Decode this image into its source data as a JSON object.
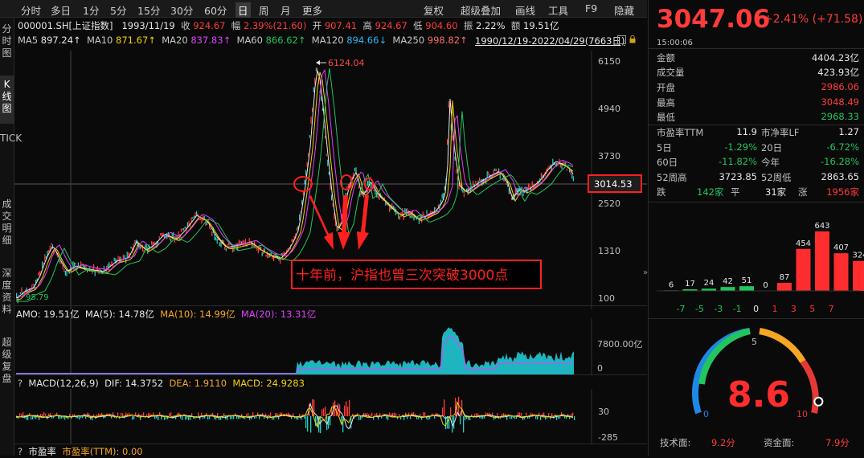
{
  "toolbar": {
    "periods": [
      "分时",
      "多日",
      "1分",
      "5分",
      "15分",
      "30分",
      "60分",
      "日",
      "周",
      "月",
      "更多"
    ],
    "active": "日",
    "tools": [
      "复权",
      "超级叠加",
      "画线",
      "工具",
      "F9",
      "隐藏"
    ]
  },
  "left_tabs": [
    "分时图",
    "K线图",
    "TICK",
    "成交明细",
    "深度资料",
    "超级复盘"
  ],
  "quote_line": {
    "code": "000001.SH[上证指数]",
    "date": "1993/11/19",
    "close_label": "收",
    "close": "924.67",
    "amp_label": "幅",
    "amp": "2.39%(21.60)",
    "open_label": "开",
    "open": "907.41",
    "high_label": "高",
    "high": "924.67",
    "low_label": "低",
    "low": "904.60",
    "swing_label": "振",
    "swing": "2.22%",
    "amount_label": "额",
    "amount": "19.51亿"
  },
  "ma_line": {
    "items": [
      {
        "label": "MA5",
        "value": "897.24↑",
        "color": "#e6e6e6"
      },
      {
        "label": "MA10",
        "value": "871.67↑",
        "color": "#f5d000"
      },
      {
        "label": "MA20",
        "value": "837.83↑",
        "color": "#e040fb"
      },
      {
        "label": "MA60",
        "value": "866.62↑",
        "color": "#22c55e"
      },
      {
        "label": "MA120",
        "value": "894.66↓",
        "color": "#29b6f6"
      },
      {
        "label": "MA250",
        "value": "998.82↑",
        "color": "#ff6b6b"
      }
    ],
    "range": "1990/12/19-2022/04/29(7663日)"
  },
  "chart": {
    "y_ticks": [
      "6150",
      "4940",
      "3730",
      "2520",
      "1310",
      "100"
    ],
    "peak_label": "6124.04",
    "low_label": "95.79",
    "current_price_tag": "3014.53",
    "annotation": "十年前，沪指也曾三次突破3000点"
  },
  "volume": {
    "legend": [
      {
        "label": "AMO: 19.51亿",
        "color": "#e6e6e6"
      },
      {
        "label": "MA(5): 14.78亿",
        "color": "#e6e6e6"
      },
      {
        "label": "MA(10): 14.99亿",
        "color": "#f5a623"
      },
      {
        "label": "MA(20): 13.31亿",
        "color": "#e040fb"
      }
    ],
    "y_ticks": [
      "7800.00亿",
      "0"
    ]
  },
  "macd": {
    "help": "?",
    "legend": [
      {
        "label": "MACD(12,26,9)",
        "color": "#e6e6e6"
      },
      {
        "label": "DIF: 14.3752",
        "color": "#e6e6e6"
      },
      {
        "label": "DEA: 1.9110",
        "color": "#f5a623"
      },
      {
        "label": "MACD: 24.9283",
        "color": "#f5d000"
      }
    ],
    "y_ticks": [
      "30",
      "-285"
    ]
  },
  "bottom_bar": {
    "help": "?",
    "label": "市盈率",
    "value": "市盈率(TTM): 0.00"
  },
  "right_panel": {
    "price": "3047.06",
    "change": "+2.41% (+71.58)",
    "time": "15:00:06",
    "rows": [
      {
        "k": "金额",
        "v": "4404.23亿",
        "color": "#e6e6e6"
      },
      {
        "k": "成交量",
        "v": "423.93亿",
        "color": "#e6e6e6"
      },
      {
        "k": "开盘",
        "v": "2986.06",
        "color": "#ff3b3b"
      },
      {
        "k": "最高",
        "v": "3048.49",
        "color": "#ff3b3b"
      },
      {
        "k": "最低",
        "v": "2968.33",
        "color": "#22c55e"
      }
    ],
    "pairs": [
      {
        "k1": "市盈率TTM",
        "v1": "11.9",
        "c1": "#e6e6e6",
        "k2": "市净率LF",
        "v2": "1.27",
        "c2": "#e6e6e6"
      },
      {
        "k1": "5日",
        "v1": "-1.29%",
        "c1": "#22c55e",
        "k2": "20日",
        "v2": "-6.72%",
        "c2": "#22c55e"
      },
      {
        "k1": "60日",
        "v1": "-11.82%",
        "c1": "#22c55e",
        "k2": "今年",
        "v2": "-16.28%",
        "c2": "#22c55e"
      },
      {
        "k1": "52周高",
        "v1": "3723.85",
        "c1": "#e6e6e6",
        "k2": "52周低",
        "v2": "2863.65",
        "c2": "#e6e6e6"
      }
    ],
    "breadth": {
      "down_label": "跌",
      "down": "142家",
      "flat_label": "平",
      "flat": "31家",
      "up_label": "涨",
      "up": "1956家"
    },
    "dist": {
      "counts": [
        6,
        17,
        24,
        42,
        51,
        0,
        87,
        454,
        643,
        407,
        324
      ],
      "labels": [
        "-7",
        "-5",
        "-3",
        "-1",
        "0",
        "1",
        "3",
        "5",
        "7"
      ]
    },
    "gauge": {
      "score": "8.6",
      "min": "0",
      "mid": "5",
      "max": "10",
      "value": 0.86,
      "tech_label": "技术面:",
      "tech": "9.2分",
      "fund_label": "资金面:",
      "fund": "7.9分"
    }
  }
}
